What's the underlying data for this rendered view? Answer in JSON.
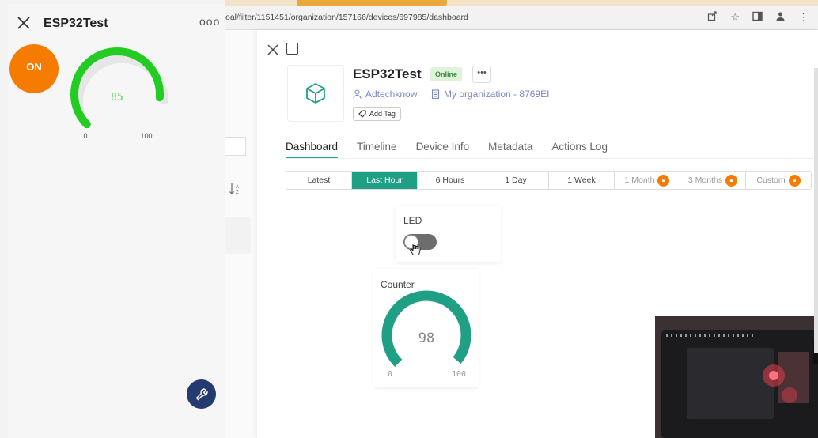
{
  "phone": {
    "title": "ESP32Test",
    "more": "ooo",
    "on_button": "ON",
    "gauge": {
      "value": "85",
      "min": "0",
      "max": "100",
      "fraction": 0.85,
      "color": "#22cc22"
    },
    "icons": {
      "close": "close-icon",
      "wrench": "wrench-icon"
    }
  },
  "browser": {
    "url": "oal/filter/1151451/organization/157166/devices/697985/dashboard",
    "icons": [
      "share-icon",
      "star-icon",
      "sidebar-icon",
      "profile-icon",
      "menu-icon"
    ]
  },
  "device": {
    "title": "ESP32Test",
    "status": "Online",
    "more": "•••",
    "owner": "Adtechknow",
    "organization": "My organization - 8769EI",
    "add_tag": "Add Tag"
  },
  "tabs": [
    {
      "label": "Dashboard",
      "active": true
    },
    {
      "label": "Timeline",
      "active": false
    },
    {
      "label": "Device Info",
      "active": false
    },
    {
      "label": "Metadata",
      "active": false
    },
    {
      "label": "Actions Log",
      "active": false
    }
  ],
  "ranges": [
    {
      "label": "Latest",
      "active": false,
      "locked": false
    },
    {
      "label": "Last Hour",
      "active": true,
      "locked": false
    },
    {
      "label": "6 Hours",
      "active": false,
      "locked": false
    },
    {
      "label": "1 Day",
      "active": false,
      "locked": false
    },
    {
      "label": "1 Week",
      "active": false,
      "locked": false
    },
    {
      "label": "1 Month",
      "active": false,
      "locked": true
    },
    {
      "label": "3 Months",
      "active": false,
      "locked": true
    },
    {
      "label": "Custom",
      "active": false,
      "locked": true
    }
  ],
  "widgets": {
    "led": {
      "title": "LED",
      "state": "off"
    },
    "counter": {
      "title": "Counter",
      "value": "98",
      "min": "0",
      "max": "100",
      "fraction": 0.98,
      "color": "#1fa085"
    }
  },
  "colors": {
    "accent": "#1fa085",
    "orange": "#f57c00",
    "link": "#7a86c4"
  }
}
